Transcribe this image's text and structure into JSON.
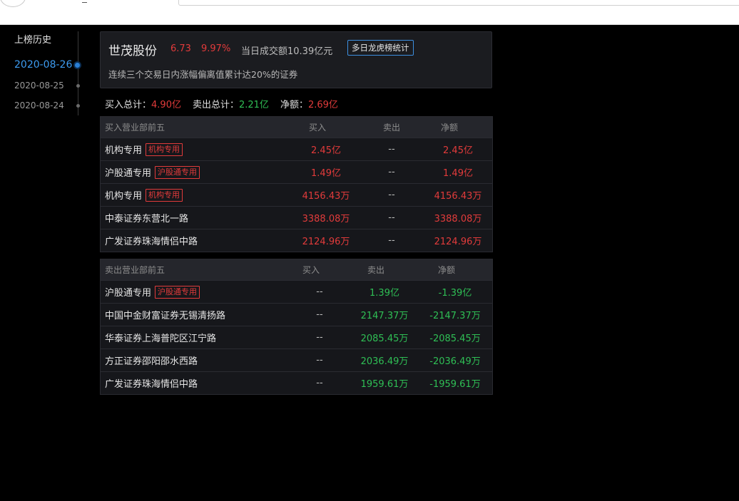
{
  "sidebar": {
    "title": "上榜历史",
    "dates": [
      "2020-08-26",
      "2020-08-25",
      "2020-08-24"
    ],
    "active_index": 0
  },
  "stock": {
    "name": "世茂股份",
    "price": "6.73",
    "change_pct": "9.97%",
    "turnover": "当日成交额10.39亿元",
    "multi_day_button": "多日龙虎榜统计",
    "reason": "连续三个交易日内涨幅偏离值累计达20%的证券"
  },
  "summary": {
    "buy_label": "买入总计：",
    "buy_value": "4.90亿",
    "sell_label": "卖出总计：",
    "sell_value": "2.21亿",
    "net_label": "净额：",
    "net_value": "2.69亿"
  },
  "buy_table": {
    "headers": [
      "买入营业部前五",
      "买入",
      "卖出",
      "净额"
    ],
    "rows": [
      {
        "name": "机构专用",
        "tag": "机构专用",
        "buy": "2.45亿",
        "sell": "--",
        "net": "2.45亿"
      },
      {
        "name": "沪股通专用",
        "tag": "沪股通专用",
        "buy": "1.49亿",
        "sell": "--",
        "net": "1.49亿"
      },
      {
        "name": "机构专用",
        "tag": "机构专用",
        "buy": "4156.43万",
        "sell": "--",
        "net": "4156.43万"
      },
      {
        "name": "中泰证券东营北一路",
        "tag": "",
        "buy": "3388.08万",
        "sell": "--",
        "net": "3388.08万"
      },
      {
        "name": "广发证券珠海情侣中路",
        "tag": "",
        "buy": "2124.96万",
        "sell": "--",
        "net": "2124.96万"
      }
    ]
  },
  "sell_table": {
    "headers": [
      "卖出营业部前五",
      "买入",
      "卖出",
      "净额"
    ],
    "rows": [
      {
        "name": "沪股通专用",
        "tag": "沪股通专用",
        "buy": "--",
        "sell": "1.39亿",
        "net": "-1.39亿"
      },
      {
        "name": "中国中金财富证券无锡清扬路",
        "tag": "",
        "buy": "--",
        "sell": "2147.37万",
        "net": "-2147.37万"
      },
      {
        "name": "华泰证券上海普陀区江宁路",
        "tag": "",
        "buy": "--",
        "sell": "2085.45万",
        "net": "-2085.45万"
      },
      {
        "name": "方正证券邵阳邵水西路",
        "tag": "",
        "buy": "--",
        "sell": "2036.49万",
        "net": "-2036.49万"
      },
      {
        "name": "广发证券珠海情侣中路",
        "tag": "",
        "buy": "--",
        "sell": "1959.61万",
        "net": "-1959.61万"
      }
    ]
  },
  "colors": {
    "up": "#e23b3b",
    "down": "#2fbf55",
    "accent": "#3d9bf0"
  }
}
